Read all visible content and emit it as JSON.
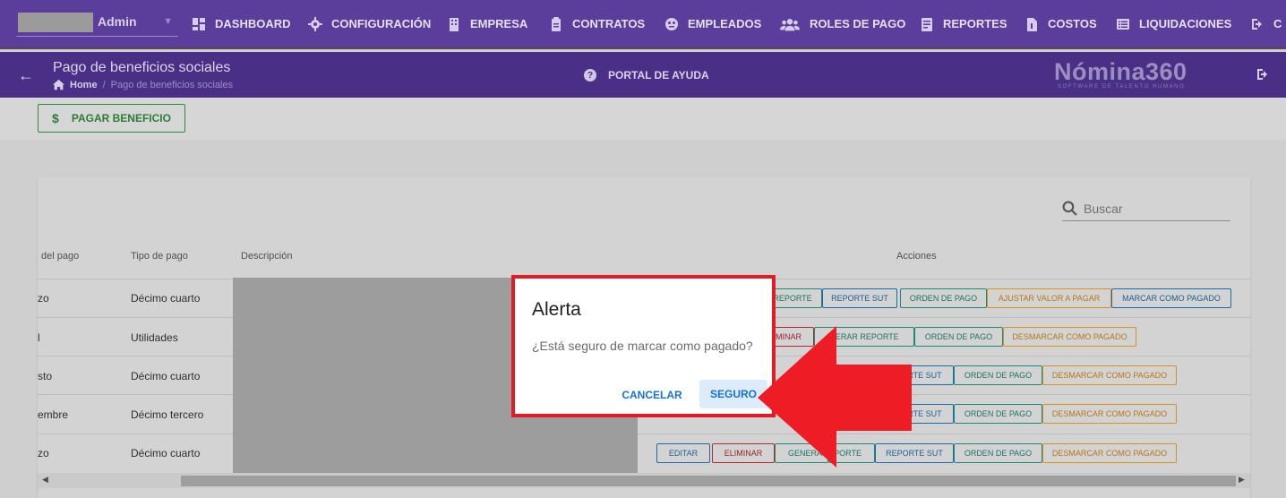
{
  "user": {
    "name": "Admin"
  },
  "nav": [
    {
      "label": "DASHBOARD",
      "icon": "dashboard-icon"
    },
    {
      "label": "CONFIGURACIÓN",
      "icon": "gear-icon"
    },
    {
      "label": "EMPRESA",
      "icon": "building-icon"
    },
    {
      "label": "CONTRATOS",
      "icon": "clipboard-icon"
    },
    {
      "label": "EMPLEADOS",
      "icon": "globe-icon"
    },
    {
      "label": "ROLES DE PAGO",
      "icon": "users-icon"
    },
    {
      "label": "REPORTES",
      "icon": "report-icon"
    },
    {
      "label": "COSTOS",
      "icon": "invoice-icon"
    },
    {
      "label": "LIQUIDACIONES",
      "icon": "list-icon"
    },
    {
      "label": "C",
      "icon": "logout-icon"
    }
  ],
  "header": {
    "title": "Pago de beneficios sociales",
    "breadcrumb_home": "Home",
    "breadcrumb_sep": "/",
    "breadcrumb_current": "Pago de beneficios sociales",
    "help": "PORTAL DE AYUDA",
    "logo": "Nómina360",
    "logo_tagline": "SOFTWARE DE TALENTO HUMANO"
  },
  "toolbar": {
    "pay_button": "PAGAR BENEFICIO",
    "pay_icon": "$"
  },
  "search": {
    "placeholder": "Buscar"
  },
  "table": {
    "headers": {
      "date": "del pago",
      "type": "Tipo de pago",
      "desc": "Descripción",
      "actions": "Acciones"
    },
    "rows": [
      {
        "date": "zo",
        "type": "Décimo cuarto"
      },
      {
        "date": "l",
        "type": "Utilidades"
      },
      {
        "date": "sto",
        "type": "Décimo cuarto"
      },
      {
        "date": "embre",
        "type": "Décimo tercero"
      },
      {
        "date": "zo",
        "type": "Décimo cuarto"
      }
    ],
    "actions": {
      "reporte": "REPORTE",
      "reporte_sut": "REPORTE SUT",
      "orden_pago": "ORDEN DE PAGO",
      "ajustar": "AJUSTAR VALOR A PAGAR",
      "marcar": "MARCAR COMO PAGADO",
      "eliminar_partial": "MINAR",
      "generar_partial": "NERAR REPORTE",
      "desmarcar": "DESMARCAR COMO PAGADO",
      "sut_partial": "RTE SUT",
      "editar": "EDITAR",
      "eliminar": "ELIMINAR",
      "genera_partial": "GENERA",
      "porte_partial": "PORTE"
    }
  },
  "dialog": {
    "title": "Alerta",
    "message": "¿Está seguro de marcar como pagado?",
    "cancel": "CANCELAR",
    "confirm": "SEGURO"
  },
  "colors": {
    "primary": "#5b3d9b",
    "accent_red": "#e21b25",
    "link_blue": "#1872d1"
  }
}
